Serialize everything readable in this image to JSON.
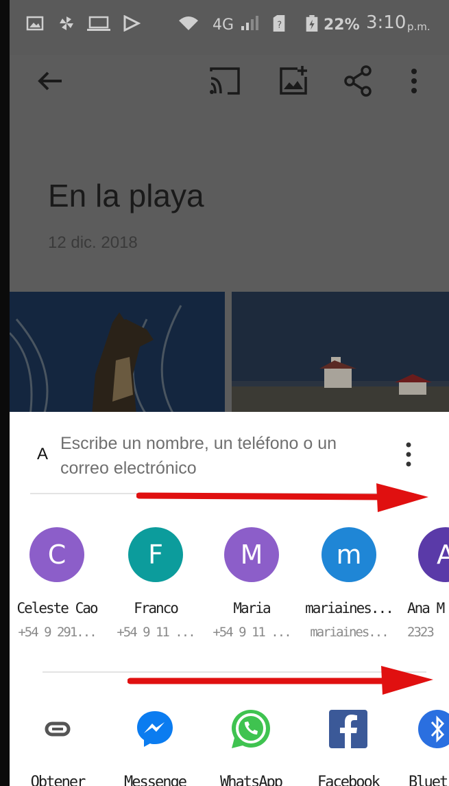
{
  "status_bar": {
    "network": "4G",
    "battery": "22%",
    "time": "3:10",
    "ampm": "p.m."
  },
  "album": {
    "title": "En la playa",
    "date": "12 dic. 2018"
  },
  "share_sheet": {
    "search_letter": "A",
    "search_placeholder": "Escribe un nombre, un teléfono o un correo electrónico",
    "contacts": [
      {
        "initial": "C",
        "name": "Celeste Cao",
        "detail": "+54 9 291...",
        "color": "#8c5ec9"
      },
      {
        "initial": "F",
        "name": "Franco",
        "detail": "+54 9 11 ...",
        "color": "#0c9c9c"
      },
      {
        "initial": "M",
        "name": "Maria",
        "detail": "+54 9 11 ...",
        "color": "#8c5ec9"
      },
      {
        "initial": "m",
        "name": "mariaines...",
        "detail": "mariaines...",
        "color": "#1f86d6"
      },
      {
        "initial": "A",
        "name": "Ana M",
        "detail": "2323",
        "color": "#5a3aa8"
      }
    ],
    "apps": [
      {
        "name": "Obtener",
        "icon": "link-icon"
      },
      {
        "name": "Messenge",
        "icon": "messenger-icon"
      },
      {
        "name": "WhatsApp",
        "icon": "whatsapp-icon"
      },
      {
        "name": "Facebook",
        "icon": "facebook-icon"
      },
      {
        "name": "Bluet",
        "icon": "bluetooth-icon"
      }
    ]
  },
  "colors": {
    "overlay_dim": "#5c5c5c",
    "sheet_bg": "#ffffff",
    "annotation_arrow": "#e01010"
  }
}
